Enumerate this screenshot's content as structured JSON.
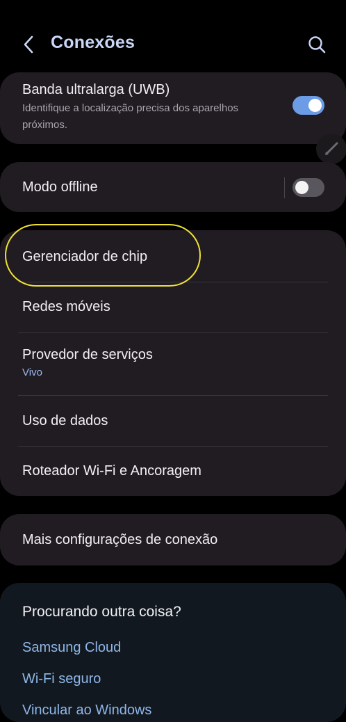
{
  "header": {
    "title": "Conexões",
    "back_icon": "chevron-left-icon",
    "search_icon": "search-icon"
  },
  "cards": {
    "uwb": {
      "title": "Banda ultralarga (UWB)",
      "subtitle": "Identifique a localização precisa dos aparelhos próximos.",
      "toggle_on": true
    },
    "offline": {
      "title": "Modo offline",
      "toggle_on": false
    },
    "network": {
      "items": [
        {
          "title": "Gerenciador de chip"
        },
        {
          "title": "Redes móveis"
        },
        {
          "title": "Provedor de serviços",
          "subtitle": "Vivo"
        },
        {
          "title": "Uso de dados"
        },
        {
          "title": "Roteador Wi-Fi e Ancoragem"
        }
      ]
    },
    "more": {
      "title": "Mais configurações de conexão"
    }
  },
  "looking": {
    "title": "Procurando outra coisa?",
    "links": [
      "Samsung Cloud",
      "Wi-Fi seguro",
      "Vincular ao Windows"
    ]
  },
  "colors": {
    "accent": "#6c9ce6",
    "highlight": "#f0e234",
    "card": "#211c22",
    "link": "#8fb7e8"
  }
}
